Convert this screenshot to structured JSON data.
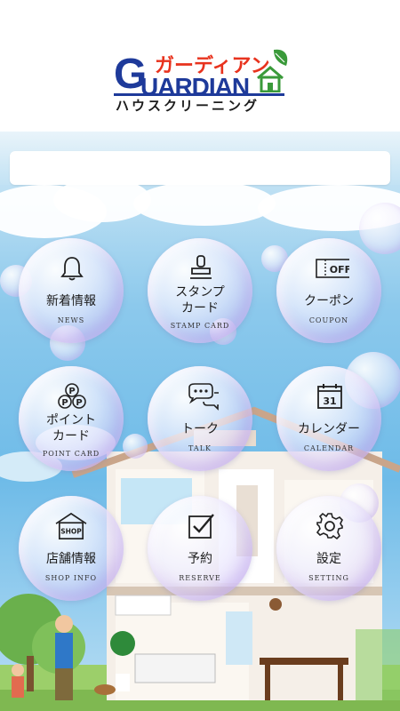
{
  "header": {
    "logo_kana": "ガーディアン",
    "logo_main": "UARDIAN",
    "logo_g": "G",
    "logo_sub": "ハウスクリーニング"
  },
  "search": {
    "placeholder": ""
  },
  "menu": [
    {
      "label": "新着情報",
      "sub": "NEWS",
      "icon": "bell-icon"
    },
    {
      "label": "スタンプ\nカード",
      "sub": "STAMP CARD",
      "icon": "stamp-icon"
    },
    {
      "label": "クーポン",
      "sub": "COUPON",
      "icon": "coupon-icon",
      "icon_text": "OFF"
    },
    {
      "label": "ポイント\nカード",
      "sub": "POINT CARD",
      "icon": "point-card-icon",
      "icon_text": "P"
    },
    {
      "label": "トーク",
      "sub": "TALK",
      "icon": "chat-bubbles-icon"
    },
    {
      "label": "カレンダー",
      "sub": "CALENDAR",
      "icon": "calendar-icon",
      "icon_text": "31"
    },
    {
      "label": "店舗情報",
      "sub": "SHOP INFO",
      "icon": "shop-icon",
      "icon_text": "SHOP"
    },
    {
      "label": "予約",
      "sub": "RESERVE",
      "icon": "checkbox-icon"
    },
    {
      "label": "設定",
      "sub": "SETTING",
      "icon": "gear-icon"
    }
  ],
  "colors": {
    "logo_red": "#e8331e",
    "logo_blue": "#1e3a9a",
    "logo_green": "#3a9a3a",
    "sky": "#6ebbe8"
  }
}
